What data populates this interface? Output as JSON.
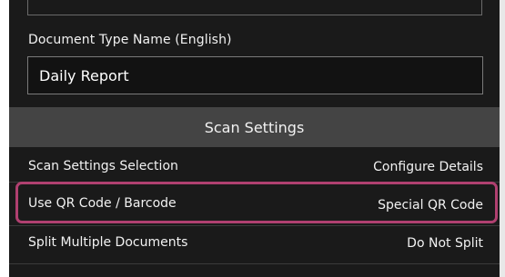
{
  "form": {
    "document_type_label": "Document Type Name (English)",
    "document_type_value": "Daily Report"
  },
  "scan_settings": {
    "header": "Scan Settings",
    "rows": [
      {
        "label": "Scan Settings Selection",
        "value": "Configure Details"
      },
      {
        "label": "Use QR Code / Barcode",
        "value": "Special QR Code"
      },
      {
        "label": "Split Multiple Documents",
        "value": "Do Not Split"
      }
    ]
  },
  "colors": {
    "background": "#1a1a1a",
    "section_header": "#444444",
    "highlight_border": "#b04070",
    "text": "#f2f2f2"
  }
}
